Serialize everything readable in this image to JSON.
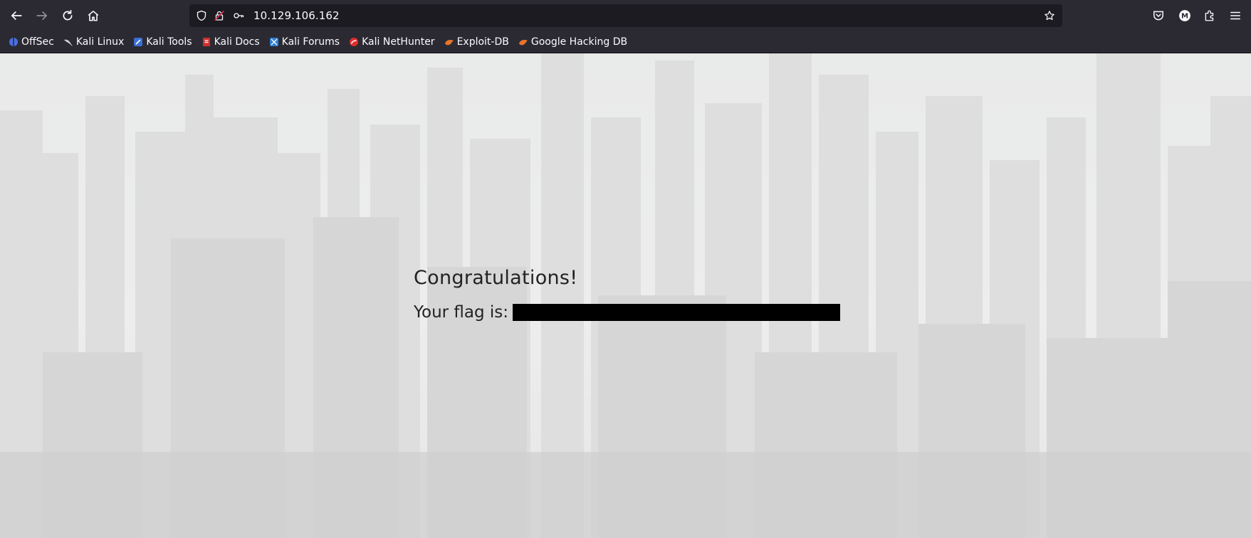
{
  "browser": {
    "url": "10.129.106.162",
    "bookmarks": [
      {
        "label": "OffSec",
        "icon": "offsec-icon"
      },
      {
        "label": "Kali Linux",
        "icon": "kali-linux-icon"
      },
      {
        "label": "Kali Tools",
        "icon": "kali-tools-icon"
      },
      {
        "label": "Kali Docs",
        "icon": "kali-docs-icon"
      },
      {
        "label": "Kali Forums",
        "icon": "kali-forums-icon"
      },
      {
        "label": "Kali NetHunter",
        "icon": "kali-nethunter-icon"
      },
      {
        "label": "Exploit-DB",
        "icon": "exploit-db-icon"
      },
      {
        "label": "Google Hacking DB",
        "icon": "google-hacking-db-icon"
      }
    ],
    "colors": {
      "chrome": "#2b2a33",
      "urlbar": "#1c1b22",
      "text": "#fbfbfe"
    }
  },
  "page": {
    "title": "Congratulations!",
    "flag_label": "Your flag is:"
  }
}
